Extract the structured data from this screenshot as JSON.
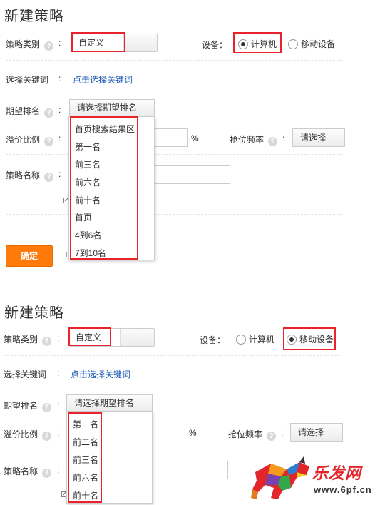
{
  "s1": {
    "title": "新建策略",
    "strategy_type_label": "策略类别",
    "strategy_type_value": "自定义",
    "device_label": "设备：",
    "device_options": [
      "计算机",
      "移动设备"
    ],
    "device_selected": "计算机",
    "keyword_label": "选择关键词",
    "keyword_link": "点击选择关键词",
    "rank_label": "期望排名",
    "rank_select": "请选择期望排名",
    "rank_options": [
      "首页搜索结果区",
      "第一名",
      "前三名",
      "前六名",
      "前十名",
      "首页",
      "4到6名",
      "7到10名"
    ],
    "premium_label": "溢价比例",
    "percent": "%",
    "frequency_label": "抢位频率",
    "frequency_select": "请选择",
    "name_label": "策略名称",
    "confirm_button": "确定"
  },
  "s2": {
    "title": "新建策略",
    "strategy_type_label": "策略类别",
    "strategy_type_value": "自定义",
    "device_label": "设备：",
    "device_options": [
      "计算机",
      "移动设备"
    ],
    "device_selected": "移动设备",
    "keyword_label": "选择关键词",
    "keyword_link": "点击选择关键词",
    "rank_label": "期望排名",
    "rank_select": "请选择期望排名",
    "rank_options": [
      "第一名",
      "前二名",
      "前三名",
      "前六名",
      "前十名"
    ],
    "premium_label": "溢价比例",
    "percent": "%",
    "frequency_label": "抢位频率",
    "frequency_select": "请选择",
    "name_label": "策略名称"
  },
  "watermark": {
    "brand": "乐发网",
    "url": "www.6pf.cn"
  },
  "colors": {
    "highlight": "#e8232c",
    "link": "#1f5bb5",
    "confirm": "#ff7a0a"
  }
}
